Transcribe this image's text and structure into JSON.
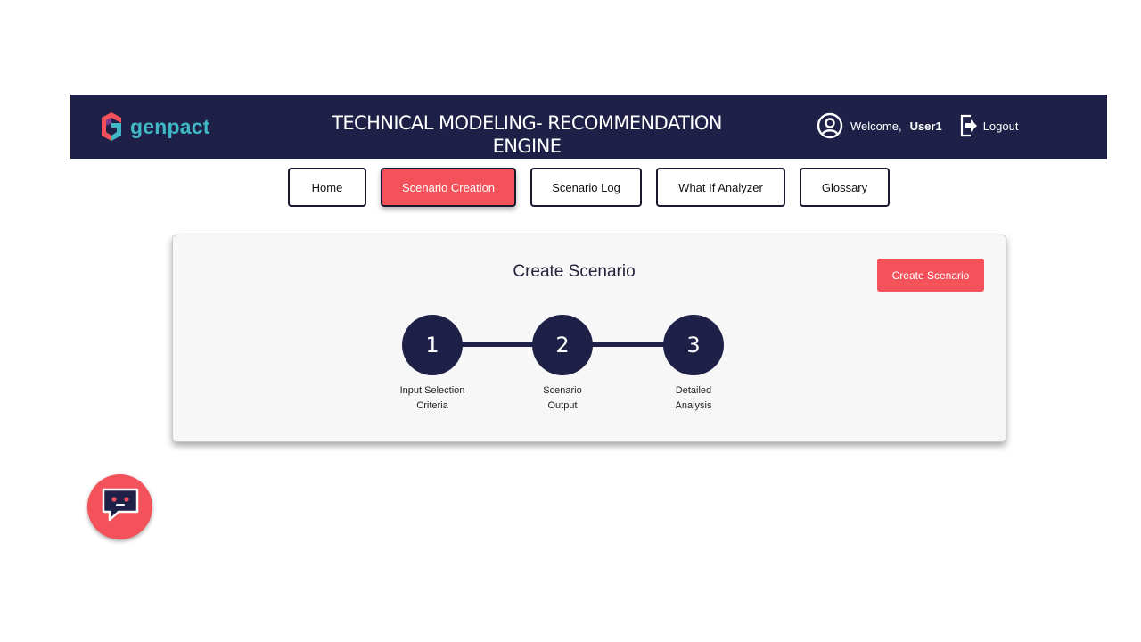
{
  "header": {
    "brand": "genpact",
    "title": "TECHNICAL MODELING- RECOMMENDATION ENGINE",
    "welcome_label": "Welcome,",
    "username": "User1",
    "logout_label": "Logout"
  },
  "nav": {
    "tabs": [
      {
        "label": "Home",
        "active": false
      },
      {
        "label": "Scenario Creation",
        "active": true
      },
      {
        "label": "Scenario Log",
        "active": false
      },
      {
        "label": "What If Analyzer",
        "active": false
      },
      {
        "label": "Glossary",
        "active": false
      }
    ]
  },
  "card": {
    "title": "Create Scenario",
    "create_button_label": "Create Scenario",
    "steps": [
      {
        "number": "1",
        "label_line1": "Input Selection",
        "label_line2": "Criteria"
      },
      {
        "number": "2",
        "label_line1": "Scenario",
        "label_line2": "Output"
      },
      {
        "number": "3",
        "label_line1": "Detailed",
        "label_line2": "Analysis"
      }
    ]
  },
  "colors": {
    "header_bg": "#1f2047",
    "accent": "#f4525a",
    "brand_teal": "#3fb7c4",
    "card_bg": "#f7f7f8"
  },
  "icons": {
    "brand": "genpact-logo-icon",
    "user": "user-circle-icon",
    "logout": "logout-icon",
    "chat": "chatbot-icon"
  }
}
